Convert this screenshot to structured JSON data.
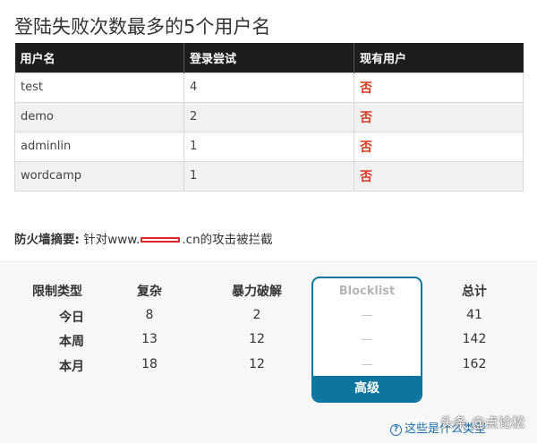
{
  "title": "登陆失败次数最多的5个用户名",
  "table": {
    "headers": [
      "用户名",
      "登录尝试",
      "现有用户"
    ],
    "rows": [
      [
        "test",
        "4",
        "否"
      ],
      [
        "demo",
        "2",
        "否"
      ],
      [
        "adminlin",
        "1",
        "否"
      ],
      [
        "wordcamp",
        "1",
        "否"
      ]
    ]
  },
  "firewall": {
    "label": "防火墙摘要:",
    "text_before": "针对www.",
    "text_after": ".cn的攻击被拦截"
  },
  "stats": {
    "headers": {
      "type": "限制类型",
      "complex": "复杂",
      "brute": "暴力破解",
      "blocklist": "Blocklist",
      "total": "总计"
    },
    "rows": [
      {
        "label": "今日",
        "complex": "8",
        "brute": "2",
        "blocklist": "—",
        "total": "41"
      },
      {
        "label": "本周",
        "complex": "13",
        "brute": "12",
        "blocklist": "—",
        "total": "142"
      },
      {
        "label": "本月",
        "complex": "18",
        "brute": "12",
        "blocklist": "—",
        "total": "162"
      }
    ],
    "upgrade_label": "高级"
  },
  "help_link": "这些是什么类型",
  "watermark": "头条 @点论松",
  "colors": {
    "header_bg": "#1d1d1d",
    "no_red": "#d9381e",
    "accent_blue": "#0d76a0"
  }
}
